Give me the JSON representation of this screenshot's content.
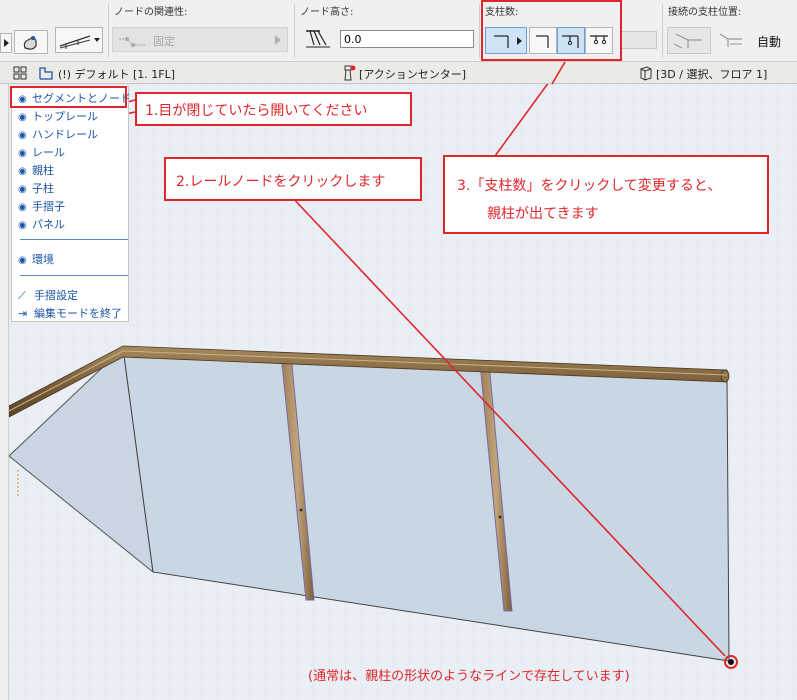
{
  "toolbar": {
    "node_relation_label": "ノードの関連性:",
    "node_relation_value": "固定",
    "node_height_label": "ノード高さ:",
    "node_height_value": "0.0",
    "post_count_label": "支柱数:",
    "post_position_label": "接続の支柱位置:",
    "post_position_value": "自動"
  },
  "tabs": {
    "view_tab": "(!) デフォルト [1. 1FL]",
    "action_center": "[アクションセンター]",
    "view_3d": "[3D / 選択、フロア 1]"
  },
  "palette": {
    "items": [
      {
        "label": "セグメントとノード"
      },
      {
        "label": "トップレール"
      },
      {
        "label": "ハンドレール"
      },
      {
        "label": "レール"
      },
      {
        "label": "親柱"
      },
      {
        "label": "子柱"
      },
      {
        "label": "手摺子"
      },
      {
        "label": "パネル"
      }
    ],
    "environment": "環境",
    "railing_settings": "手摺設定",
    "exit_edit_mode": "編集モードを終了"
  },
  "callouts": {
    "step1": "1.目が閉じていたら開いてください",
    "step2": "2.レールノードをクリックします",
    "step3_line1": "3.「支柱数」をクリックして変更すると、",
    "step3_line2": "親柱が出てきます",
    "note": "(通常は、親柱の形状のようなラインで存在しています)"
  },
  "colors": {
    "annotation_red": "#e0262b",
    "link_blue": "#1a55a8",
    "active_blue": "#cfe3f7"
  }
}
